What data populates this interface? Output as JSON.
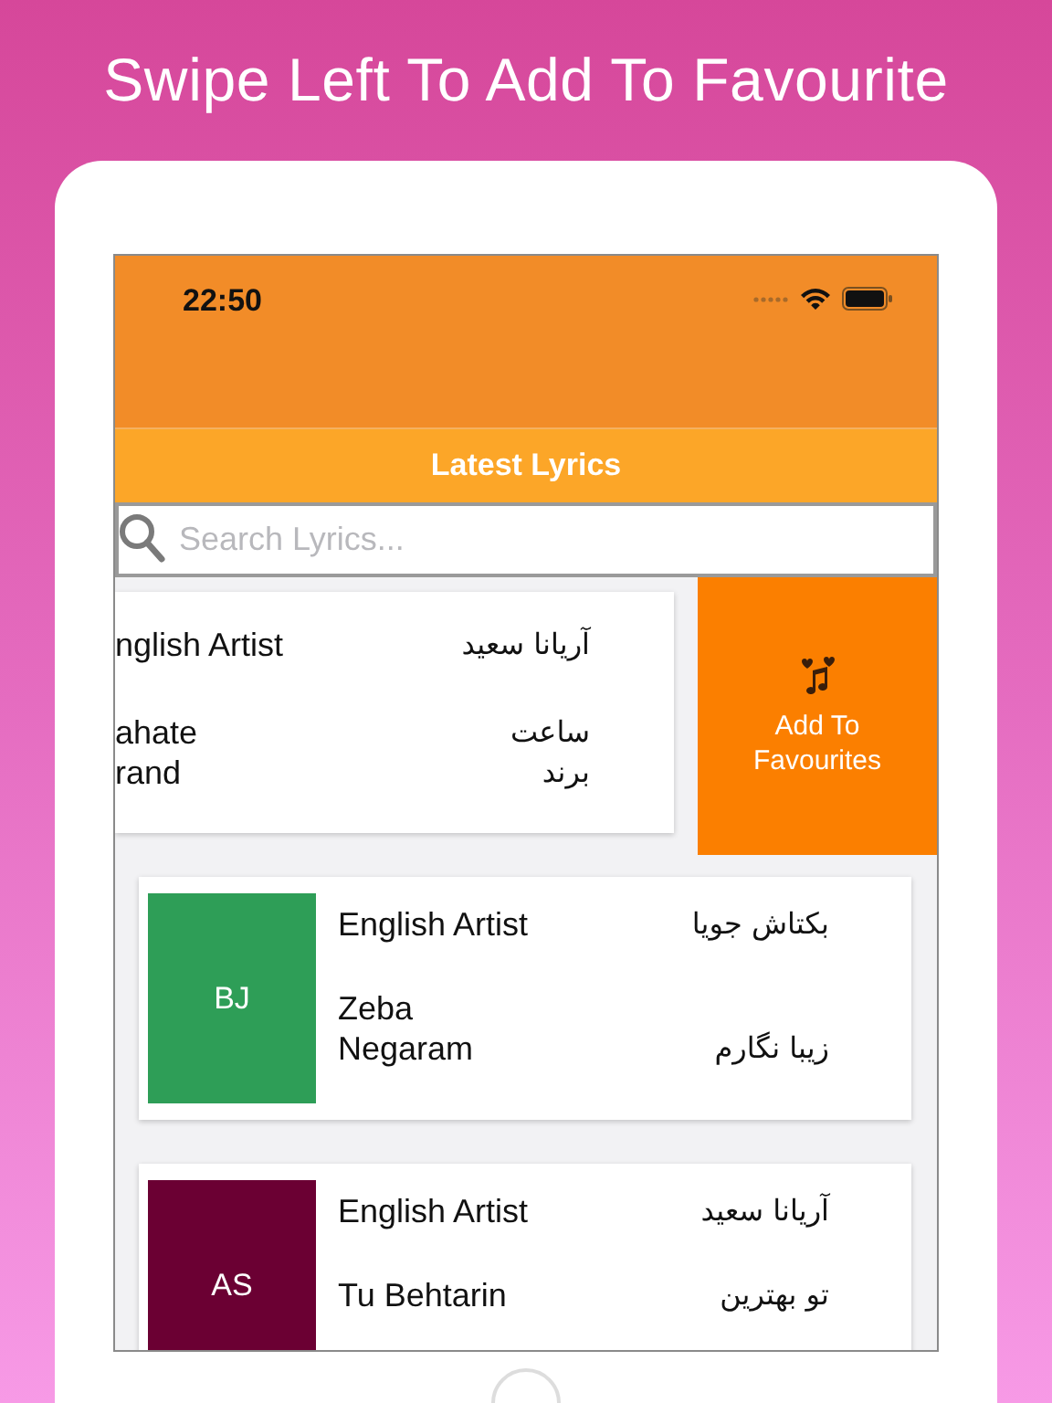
{
  "headline": "Swipe Left To Add To Favourite",
  "status_bar": {
    "time": "22:50"
  },
  "nav_title": "Latest Lyrics",
  "search": {
    "placeholder": "Search Lyrics..."
  },
  "rows": [
    {
      "kind": "swiped",
      "artist_en": "nglish Artist",
      "song_en": "ahate\nrand",
      "artist_fa": "آریانا سعید",
      "song_fa": "ساعت\nبرند",
      "action_label": "Add To Favourites"
    },
    {
      "kind": "normal",
      "initials": "BJ",
      "color": "#2e9e57",
      "artist_en": "English Artist",
      "song_en": "Zeba\nNegaram",
      "artist_fa": "بکتاش جویا",
      "song_fa": "زیبا نگارم"
    },
    {
      "kind": "normal",
      "initials": "AS",
      "color": "#6b0033",
      "artist_en": "English Artist",
      "song_en": "Tu Behtarin",
      "artist_fa": "آریانا سعید",
      "song_fa": "تو بهترین"
    }
  ]
}
